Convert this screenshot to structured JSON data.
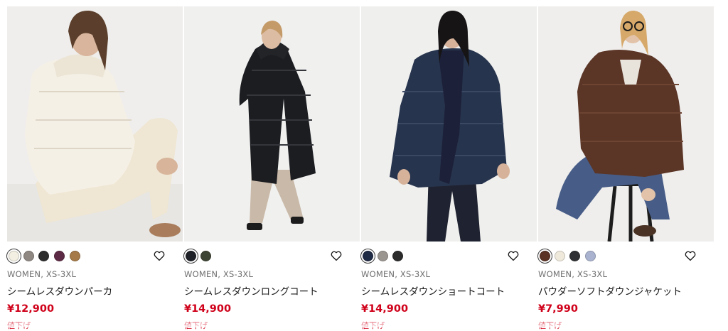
{
  "products": [
    {
      "meta": "WOMEN, XS-3XL",
      "name": "シームレスダウンパーカ",
      "price": "¥12,900",
      "tag": "値下げ",
      "colors": [
        "#f3efe2",
        "#8f8782",
        "#2c2c2c",
        "#5c2a44",
        "#a57a48"
      ],
      "selected_color": 0,
      "favorite_icon": "heart-outline-icon"
    },
    {
      "meta": "WOMEN, XS-3XL",
      "name": "シームレスダウンロングコート",
      "price": "¥14,900",
      "tag": "値下げ",
      "colors": [
        "#1e2127",
        "#3d4433"
      ],
      "selected_color": 0,
      "favorite_icon": "heart-outline-icon"
    },
    {
      "meta": "WOMEN, XS-3XL",
      "name": "シームレスダウンショートコート",
      "price": "¥14,900",
      "tag": "値下げ",
      "colors": [
        "#1f2a44",
        "#9b9590",
        "#2b2b2b"
      ],
      "selected_color": 0,
      "favorite_icon": "heart-outline-icon"
    },
    {
      "meta": "WOMEN, XS-3XL",
      "name": "パウダーソフトダウンジャケット",
      "price": "¥7,990",
      "tag": "値下げ",
      "colors": [
        "#5a3324",
        "#efe9dc",
        "#2f3033",
        "#a9b3cf"
      ],
      "selected_color": 0,
      "favorite_icon": "heart-outline-icon"
    }
  ],
  "colors": {
    "price_red": "#d0021b",
    "meta_gray": "#6f6f6f"
  }
}
